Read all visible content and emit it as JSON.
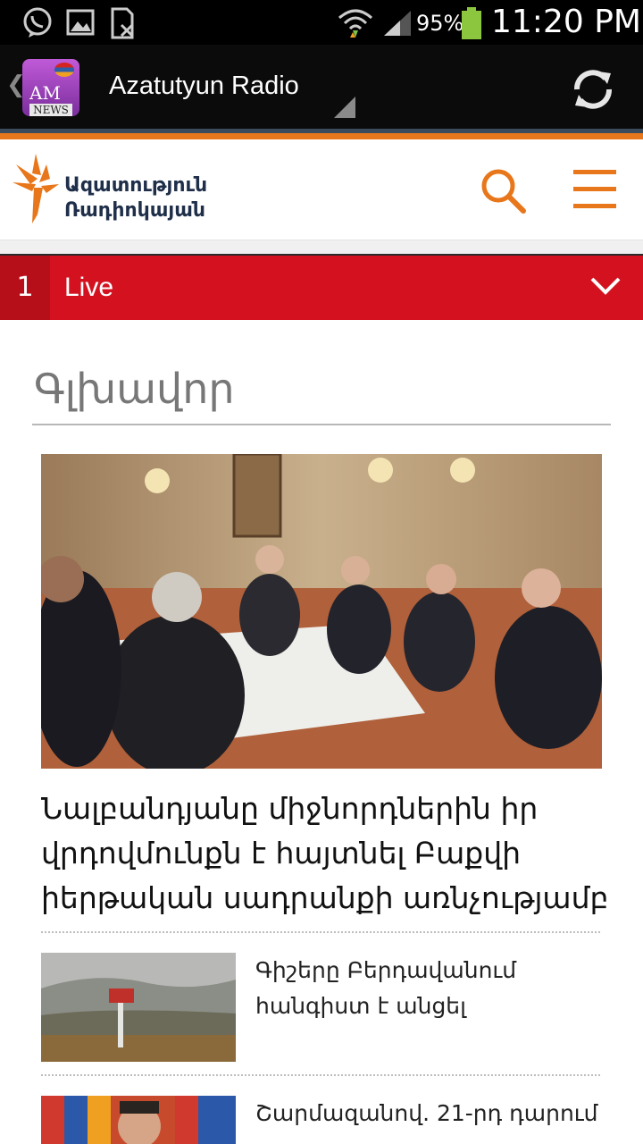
{
  "status_bar": {
    "battery_percent": "95%",
    "clock": "11:20 PM"
  },
  "app_bar": {
    "title": "Azatutyun Radio",
    "icon_text": "AM",
    "icon_subtext": "NEWS"
  },
  "site_header": {
    "logo_line1": "Ազատություն",
    "logo_line2": "Ռադիոկայան"
  },
  "live_bar": {
    "count": "1",
    "label": "Live"
  },
  "section": {
    "title": "Գլխավոր"
  },
  "hero": {
    "headline": "Նալբանդյանը միջնորդներին իր վրդովմունքն է հայտնել Բաքվի իերթական սադրանքի առնչությամբ"
  },
  "stories": [
    {
      "title": "Գիշերը Բերդավանում հանգիստ է անցել"
    },
    {
      "title": "Շարմազանով. 21-րդ դարում"
    }
  ],
  "colors": {
    "accent_orange": "#e8761a",
    "live_red": "#d4121f",
    "app_bar_bg": "#0b0b0b"
  }
}
